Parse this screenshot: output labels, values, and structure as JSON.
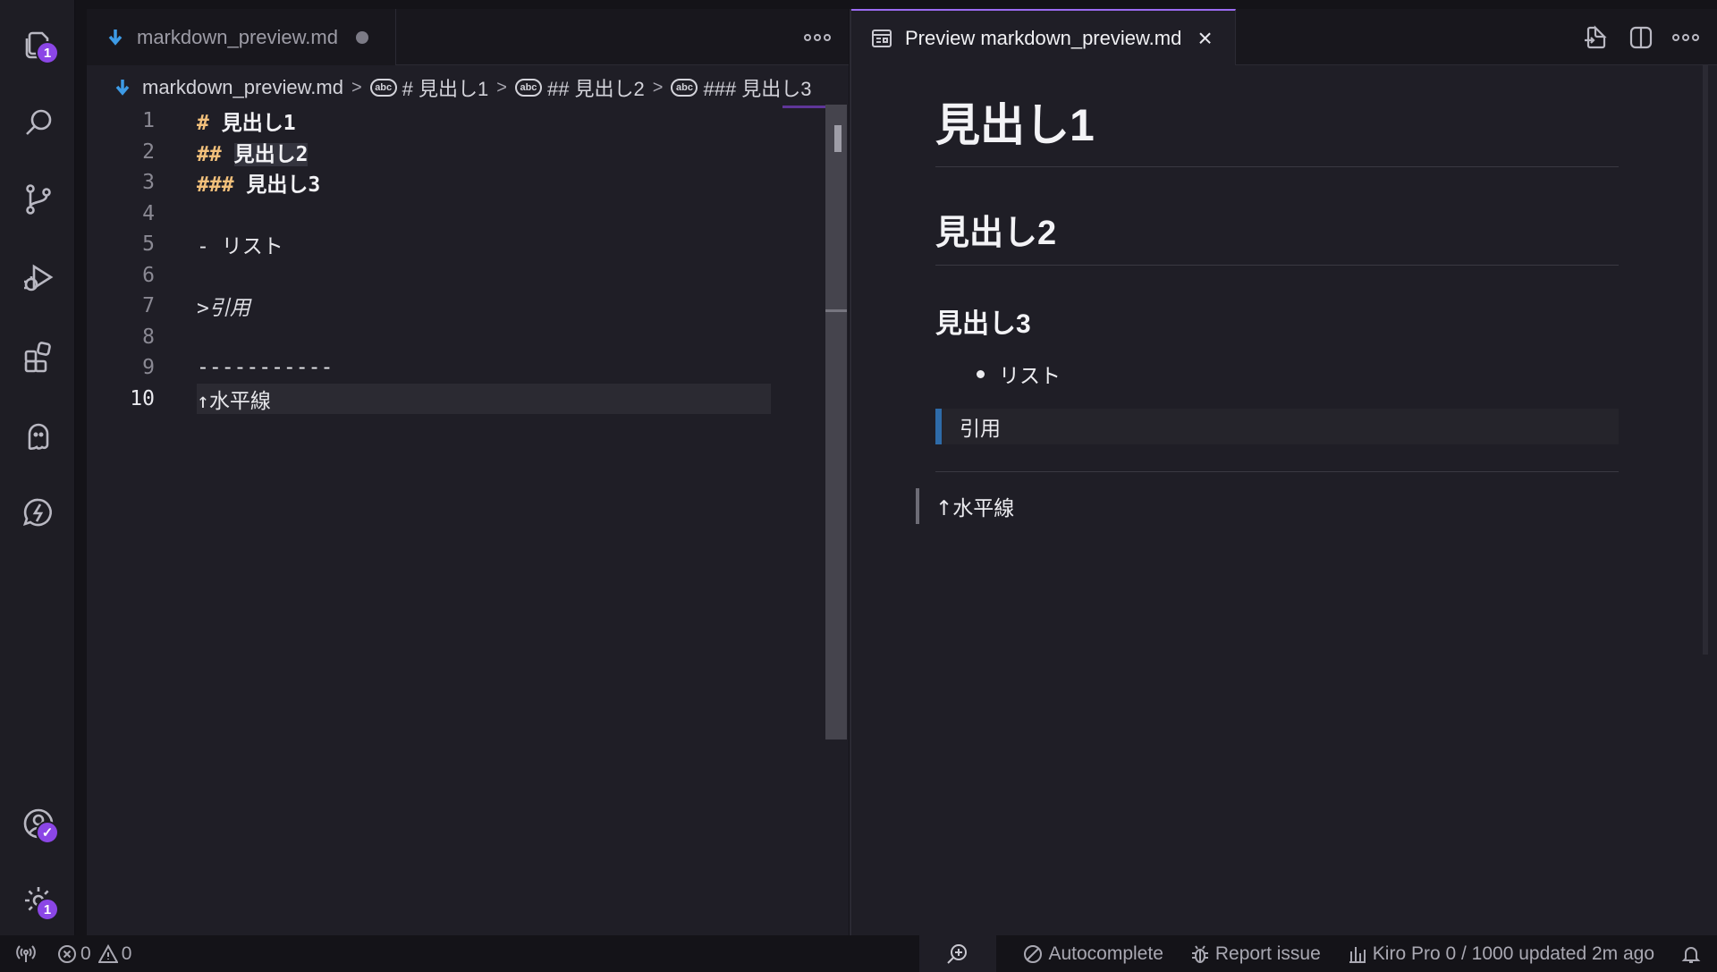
{
  "activity_bar": {
    "explorer_badge": "1",
    "accounts_badge": "✓",
    "settings_badge": "1"
  },
  "editor": {
    "tab_label": "markdown_preview.md",
    "breadcrumb": {
      "file": "markdown_preview.md",
      "h1": "# 見出し1",
      "h2": "## 見出し2",
      "h3": "### 見出し3"
    },
    "lines": [
      {
        "num": "1",
        "marker": "#",
        "text": "見出し1"
      },
      {
        "num": "2",
        "marker": "##",
        "text": "見出し2"
      },
      {
        "num": "3",
        "marker": "###",
        "text": "見出し3"
      },
      {
        "num": "4",
        "text": ""
      },
      {
        "num": "5",
        "text": "- リスト"
      },
      {
        "num": "6",
        "text": ""
      },
      {
        "num": "7",
        "text": ">引用"
      },
      {
        "num": "8",
        "text": ""
      },
      {
        "num": "9",
        "text": "-----------"
      },
      {
        "num": "10",
        "text": "↑水平線"
      }
    ]
  },
  "preview": {
    "tab_label": "Preview markdown_preview.md",
    "h1": "見出し1",
    "h2": "見出し2",
    "h3": "見出し3",
    "list_item": "リスト",
    "quote": "引用",
    "last_line": "↑水平線"
  },
  "status_bar": {
    "errors": "0",
    "warnings": "0",
    "autocomplete": "Autocomplete",
    "report_issue": "Report issue",
    "plan": "Kiro Pro 0 / 1000 updated 2m ago"
  },
  "colors": {
    "accent": "#8b46e6",
    "heading_marker": "#f2c07b",
    "quote_bar": "#2e6ba8"
  }
}
